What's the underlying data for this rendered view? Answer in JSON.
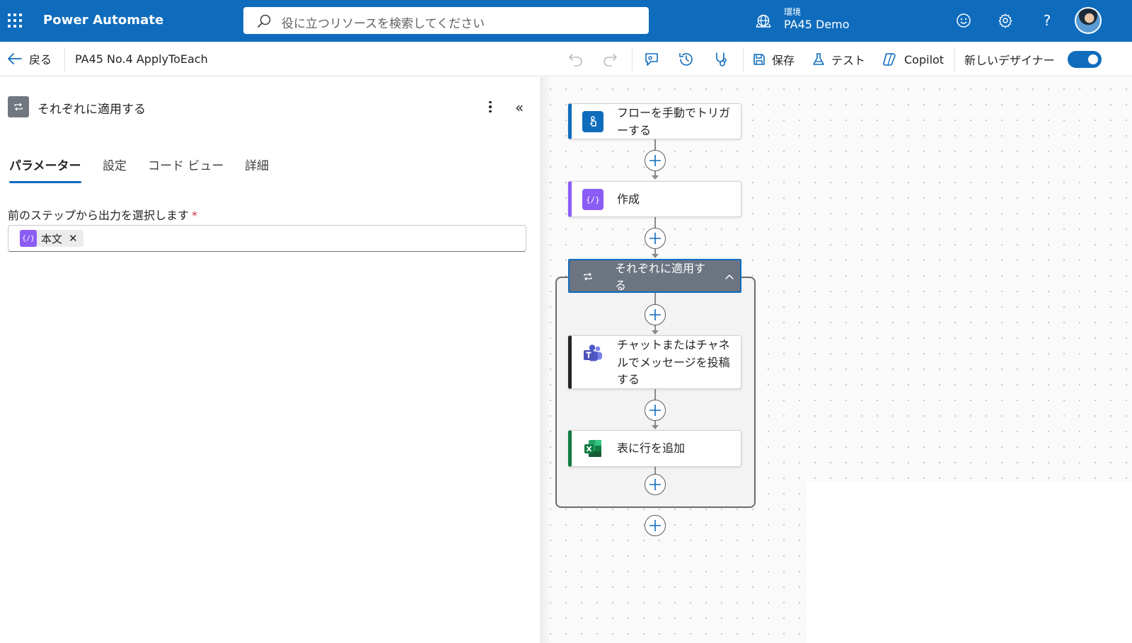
{
  "header": {
    "app_name": "Power Automate",
    "search_placeholder": "役に立つリソースを検索してください",
    "environment_label": "環境",
    "environment_name": "PA45 Demo",
    "brand_color": "#0f6cbd"
  },
  "command_bar": {
    "back_label": "戻る",
    "flow_name": "PA45 No.4 ApplyToEach",
    "save_label": "保存",
    "test_label": "テスト",
    "copilot_label": "Copilot",
    "new_designer_label": "新しいデザイナー",
    "new_designer_on": true
  },
  "panel": {
    "title": "それぞれに適用する",
    "tabs": [
      {
        "label": "パラメーター",
        "active": true
      },
      {
        "label": "設定",
        "active": false
      },
      {
        "label": "コード ビュー",
        "active": false
      },
      {
        "label": "詳細",
        "active": false
      }
    ],
    "field_label": "前のステップから出力を選択します",
    "required_mark": "*",
    "token_label": "本文",
    "token_close": "✕"
  },
  "canvas": {
    "cards": [
      {
        "title": "フローを手動でトリガーする",
        "icon": "manual-trigger-icon",
        "accent": "#0f6cbd"
      },
      {
        "title": "作成",
        "icon": "compose-icon",
        "accent": "#8b5cf6"
      },
      {
        "title": "チャットまたはチャネルでメッセージを投稿する",
        "icon": "teams-icon",
        "accent": "#242424"
      },
      {
        "title": "表に行を追加",
        "icon": "excel-icon",
        "accent": "#107c41"
      }
    ],
    "scope": {
      "title": "それぞれに適用する",
      "icon": "loop-icon"
    }
  }
}
